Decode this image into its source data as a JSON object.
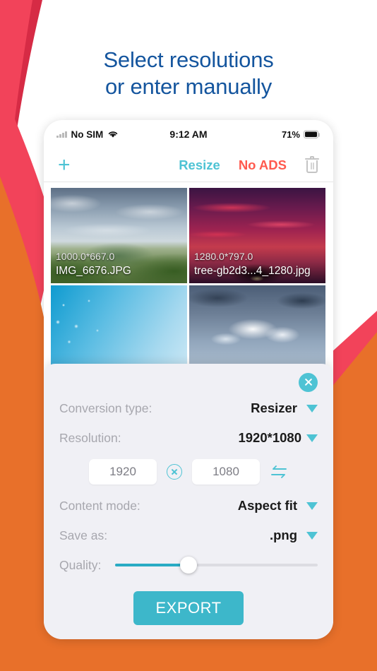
{
  "headline": {
    "line1": "Select resolutions",
    "line2": "or enter manually",
    "color": "#14559E"
  },
  "theme": {
    "teal": "#4EC3D4",
    "teal_dark": "#3DB7CA",
    "red": "#FF5A4E",
    "crimson": "#E8364F",
    "orange": "#E8702A",
    "panel_bg": "#F0F0F5"
  },
  "status_bar": {
    "carrier": "No SIM",
    "time": "9:12 AM",
    "battery": "71%",
    "signal_icon": "signal-bars-icon",
    "wifi_icon": "wifi-icon",
    "battery_icon": "battery-icon"
  },
  "toolbar": {
    "add_icon": "plus-icon",
    "resize_label": "Resize",
    "no_ads_label": "No ADS",
    "delete_icon": "trash-icon"
  },
  "gallery": {
    "items": [
      {
        "dimensions": "1000.0*667.0",
        "filename": "IMG_6676.JPG",
        "art": "art-mountain"
      },
      {
        "dimensions": "1280.0*797.0",
        "filename": "tree-gb2d3...4_1280.jpg",
        "art": "art-tree"
      },
      {
        "dimensions": "",
        "filename": "",
        "art": "art-water"
      },
      {
        "dimensions": "",
        "filename": "",
        "art": "art-clouds"
      }
    ]
  },
  "panel": {
    "close_icon": "close-icon",
    "conversion_type": {
      "label": "Conversion type:",
      "value": "Resizer",
      "caret_icon": "chevron-down-icon"
    },
    "resolution": {
      "label": "Resolution:",
      "value": "1920*1080",
      "caret_icon": "chevron-down-icon"
    },
    "dimensions": {
      "width_value": "1920",
      "height_value": "1080",
      "multiply_icon": "multiply-circle-icon",
      "swap_icon": "swap-arrows-icon"
    },
    "content_mode": {
      "label": "Content mode:",
      "value": "Aspect fit",
      "caret_icon": "chevron-down-icon"
    },
    "save_as": {
      "label": "Save as:",
      "value": ".png",
      "caret_icon": "chevron-down-icon"
    },
    "quality": {
      "label": "Quality:",
      "percent": 36
    },
    "export_label": "EXPORT"
  }
}
